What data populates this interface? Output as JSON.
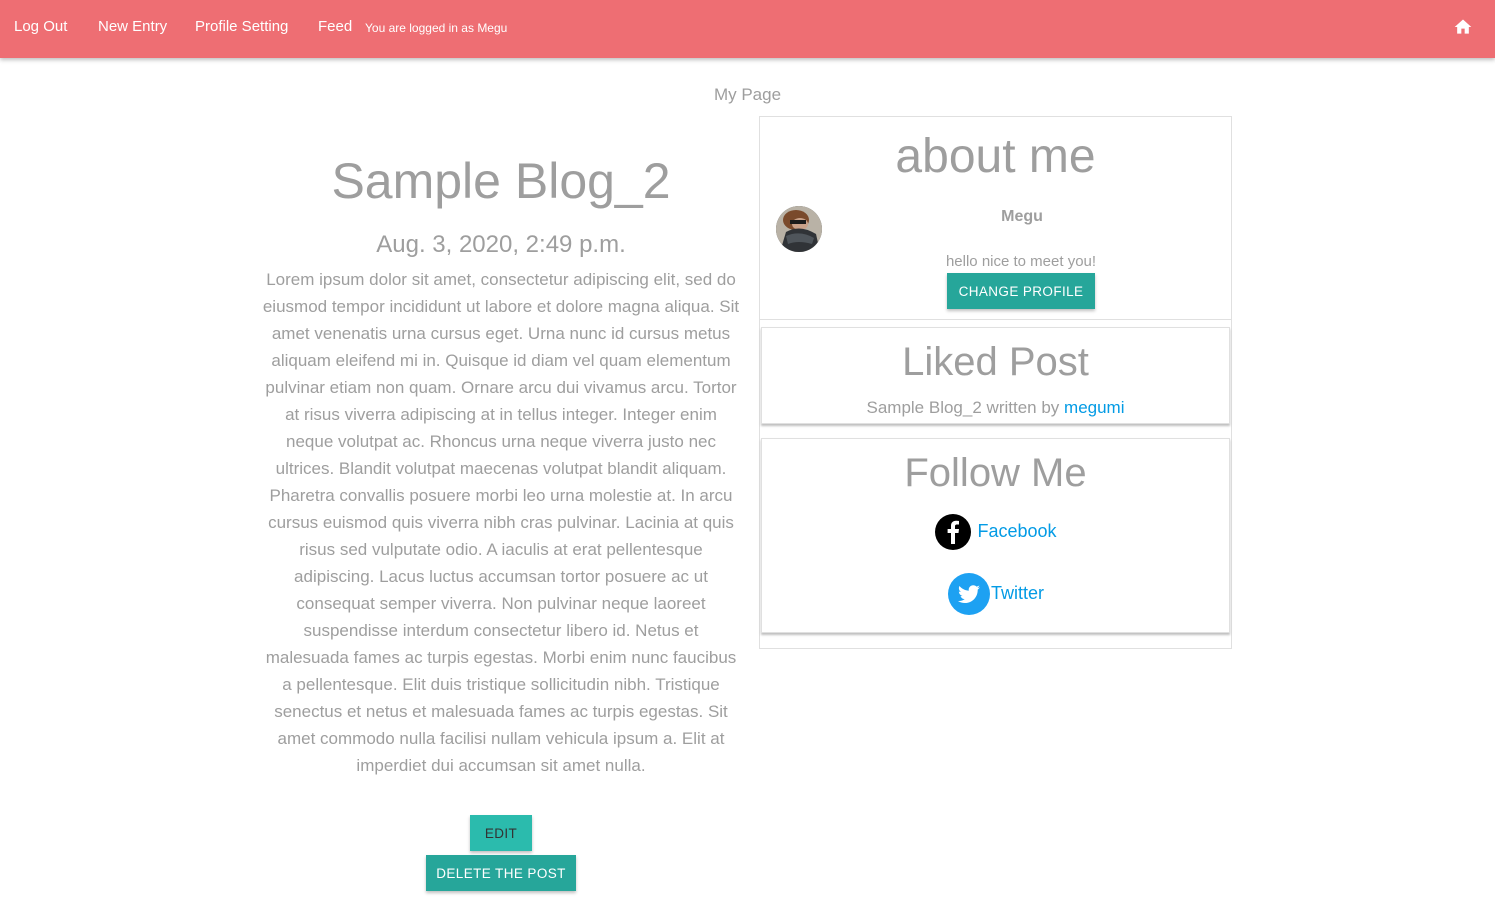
{
  "nav": {
    "logout": "Log Out",
    "new_entry": "New Entry",
    "profile_setting": "Profile Setting",
    "feed": "Feed",
    "status": "You are logged in as Megu",
    "home_icon": "home-icon",
    "color": "#ee6e73"
  },
  "page": {
    "title": "My Page"
  },
  "post": {
    "title": "Sample Blog_2",
    "date": "Aug. 3, 2020, 2:49 p.m.",
    "body": "Lorem ipsum dolor sit amet, consectetur adipiscing elit, sed do eiusmod tempor incididunt ut labore et dolore magna aliqua. Sit amet venenatis urna cursus eget. Urna nunc id cursus metus aliquam eleifend mi in. Quisque id diam vel quam elementum pulvinar etiam non quam. Ornare arcu dui vivamus arcu. Tortor at risus viverra adipiscing at in tellus integer. Integer enim neque volutpat ac. Rhoncus urna neque viverra justo nec ultrices. Blandit volutpat maecenas volutpat blandit aliquam. Pharetra convallis posuere morbi leo urna molestie at. In arcu cursus euismod quis viverra nibh cras pulvinar. Lacinia at quis risus sed vulputate odio. A iaculis at erat pellentesque adipiscing. Lacus luctus accumsan tortor posuere ac ut consequat semper viverra. Non pulvinar neque laoreet suspendisse interdum consectetur libero id. Netus et malesuada fames ac turpis egestas. Morbi enim nunc faucibus a pellentesque. Elit duis tristique sollicitudin nibh. Tristique senectus et netus et malesuada fames ac turpis egestas. Sit amet commodo nulla facilisi nullam vehicula ipsum a. Elit at imperdiet dui accumsan sit amet nulla.",
    "edit_label": "EDIT",
    "delete_label": "DELETE THE POST",
    "button_color": "#26a69a"
  },
  "about": {
    "heading": "about me",
    "name": "Megu",
    "bio": "hello nice to meet you!",
    "change_profile_label": "CHANGE PROFILE"
  },
  "liked": {
    "heading": "Liked Post",
    "post_title": "Sample Blog_2",
    "written_by": "written by",
    "author": "megumi"
  },
  "follow": {
    "heading": "Follow Me",
    "facebook": "Facebook",
    "twitter": "Twitter",
    "facebook_icon": "facebook-icon",
    "twitter_icon": "twitter-icon"
  }
}
